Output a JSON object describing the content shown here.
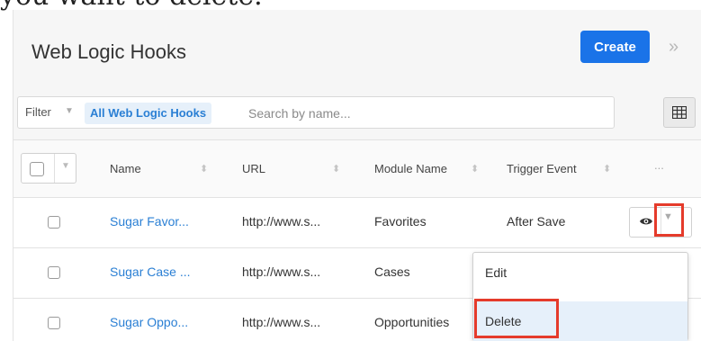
{
  "doc": {
    "text": "you want to delete."
  },
  "header": {
    "title": "Web Logic Hooks",
    "create_label": "Create"
  },
  "filter": {
    "label": "Filter",
    "tag": "All Web Logic Hooks",
    "search_placeholder": "Search by name..."
  },
  "table": {
    "columns": [
      "Name",
      "URL",
      "Module Name",
      "Trigger Event"
    ],
    "more_label": "...",
    "rows": [
      {
        "name": "Sugar Favor...",
        "url": "http://www.s...",
        "module": "Favorites",
        "trigger": "After Save"
      },
      {
        "name": "Sugar Case ...",
        "url": "http://www.s...",
        "module": "Cases",
        "trigger": ""
      },
      {
        "name": "Sugar Oppo...",
        "url": "http://www.s...",
        "module": "Opportunities",
        "trigger": ""
      }
    ]
  },
  "menu": {
    "items": [
      "Edit",
      "Delete"
    ]
  },
  "colors": {
    "accent": "#1a73e8",
    "link": "#2a7fd4",
    "highlight": "#e53b2b"
  },
  "icons": [
    "expand-icon",
    "grid-view-icon",
    "eye-icon",
    "caret-down-icon",
    "sort-icon"
  ]
}
